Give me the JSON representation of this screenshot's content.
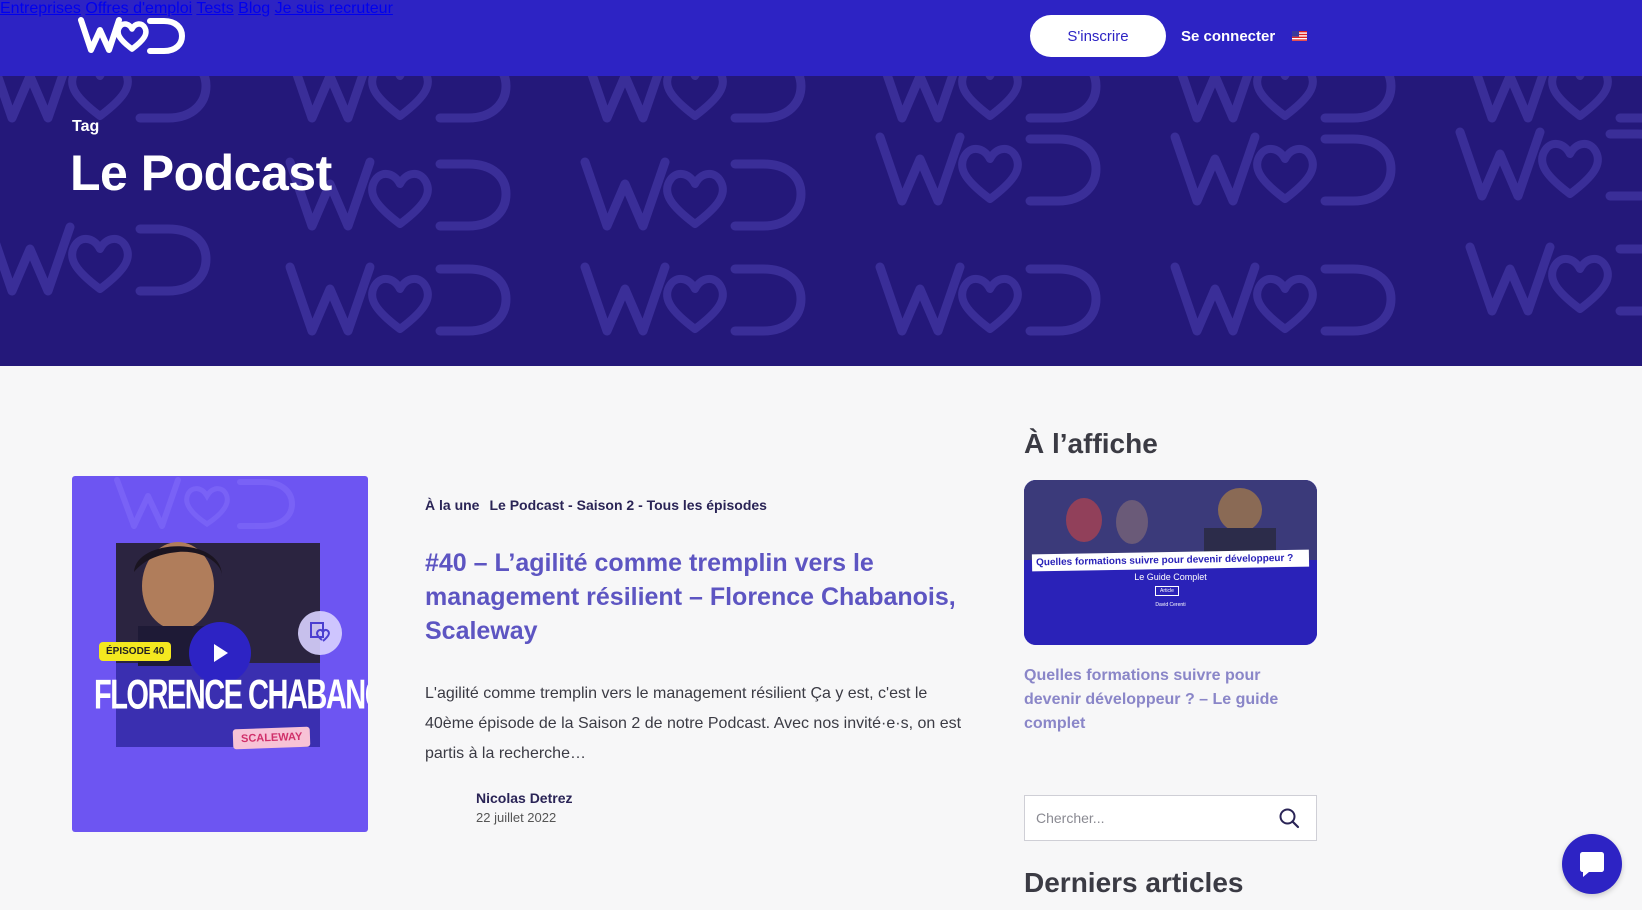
{
  "header": {
    "nav": [
      "Entreprises",
      "Offres d'emploi",
      "Tests",
      "Blog",
      "Je suis recruteur"
    ],
    "signup_label": "S'inscrire",
    "login_label": "Se connecter",
    "flag_icon": "us-flag-icon"
  },
  "hero": {
    "tag_label": "Tag",
    "title": "Le Podcast"
  },
  "article": {
    "thumbnail": {
      "episode_badge": "ÉPISODE 40",
      "guest_name": "FLORENCE CHABANOIS",
      "company_badge": "SCALEWAY"
    },
    "categories": [
      "À la une",
      "Le Podcast - Saison 2 - Tous les épisodes"
    ],
    "title": "#40 – L’agilité comme tremplin vers le management résilient – Florence Chabanois, Scaleway",
    "excerpt": "L'agilité comme tremplin vers le management résilient Ça y est, c'est le 40ème épisode de la Saison 2 de notre Podcast. Avec nos invité·e·s, on est partis à la recherche…",
    "author": "Nicolas Detrez",
    "date": "22 juillet 2022"
  },
  "sidebar": {
    "featured_heading": "À l’affiche",
    "featured_image": {
      "banner_text": "Quelles formations suivre pour devenir développeur ?",
      "subtitle": "Le Guide Complet",
      "badge": "Article",
      "author": "David Cerenti"
    },
    "featured_link": "Quelles formations suivre pour devenir développeur ? – Le guide complet",
    "search_placeholder": "Chercher...",
    "latest_heading": "Derniers articles"
  },
  "colors": {
    "header_bg": "#2d23c4",
    "hero_bg": "#24187a",
    "thumb_bg": "#6d55f2",
    "title_color": "#5d55c2",
    "episode_badge": "#f4e81f",
    "company_badge": "#f7c2d6"
  }
}
